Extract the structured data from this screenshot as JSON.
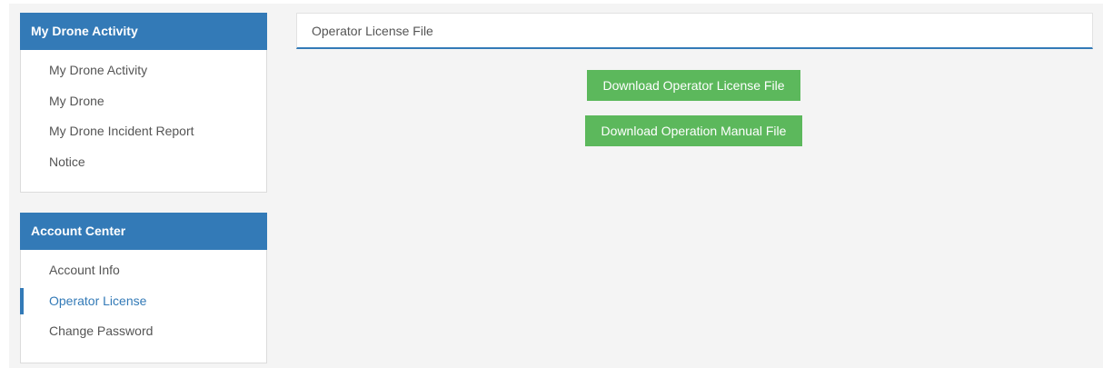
{
  "sidebar": {
    "activity": {
      "title": "My Drone Activity",
      "items": [
        {
          "label": "My Drone Activity"
        },
        {
          "label": "My Drone"
        },
        {
          "label": "My Drone Incident Report"
        },
        {
          "label": "Notice"
        }
      ]
    },
    "account": {
      "title": "Account Center",
      "items": [
        {
          "label": "Account Info"
        },
        {
          "label": "Operator License",
          "active": true
        },
        {
          "label": "Change Password"
        }
      ]
    }
  },
  "main": {
    "title": "Operator License File",
    "buttons": {
      "license": "Download Operator License File",
      "manual": "Download Operation Manual File"
    }
  },
  "colors": {
    "primary": "#337ab7",
    "success": "#5cb85c",
    "background": "#f4f4f4"
  }
}
